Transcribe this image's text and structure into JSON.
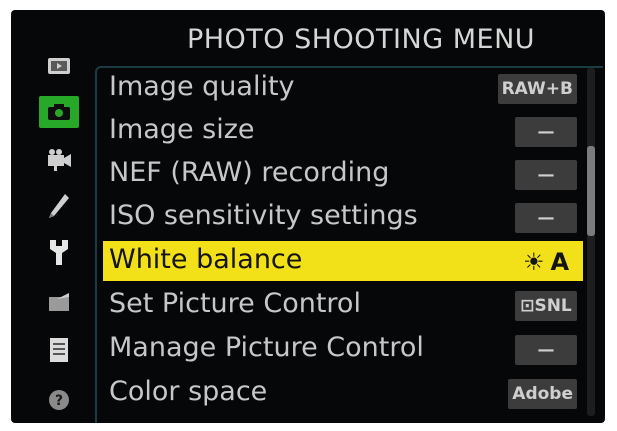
{
  "menu": {
    "title": "PHOTO SHOOTING MENU",
    "items": [
      {
        "label": "Image quality",
        "value": "RAW+B"
      },
      {
        "label": "Image size",
        "value": "—"
      },
      {
        "label": "NEF (RAW) recording",
        "value": "—"
      },
      {
        "label": "ISO sensitivity settings",
        "value": "—"
      },
      {
        "label": "White balance",
        "value": "A",
        "value_icon": "sun-icon"
      },
      {
        "label": "Set Picture Control",
        "value": "⊡SNL"
      },
      {
        "label": "Manage Picture Control",
        "value": "—"
      },
      {
        "label": "Color space",
        "value": "Adobe"
      }
    ],
    "selected_index": 4
  },
  "sidebar": {
    "tabs": [
      {
        "icon": "playback-icon"
      },
      {
        "icon": "camera-icon",
        "active": true
      },
      {
        "icon": "movie-icon"
      },
      {
        "icon": "pencil-icon"
      },
      {
        "icon": "wrench-icon"
      },
      {
        "icon": "retouch-icon"
      },
      {
        "icon": "my-menu-icon"
      },
      {
        "icon": "help-icon"
      }
    ]
  },
  "colors": {
    "background": "#060708",
    "highlight": "#f2e019",
    "active_tab": "#27a829",
    "text": "#c7c7c7",
    "value_box": "#3c3c3c"
  }
}
